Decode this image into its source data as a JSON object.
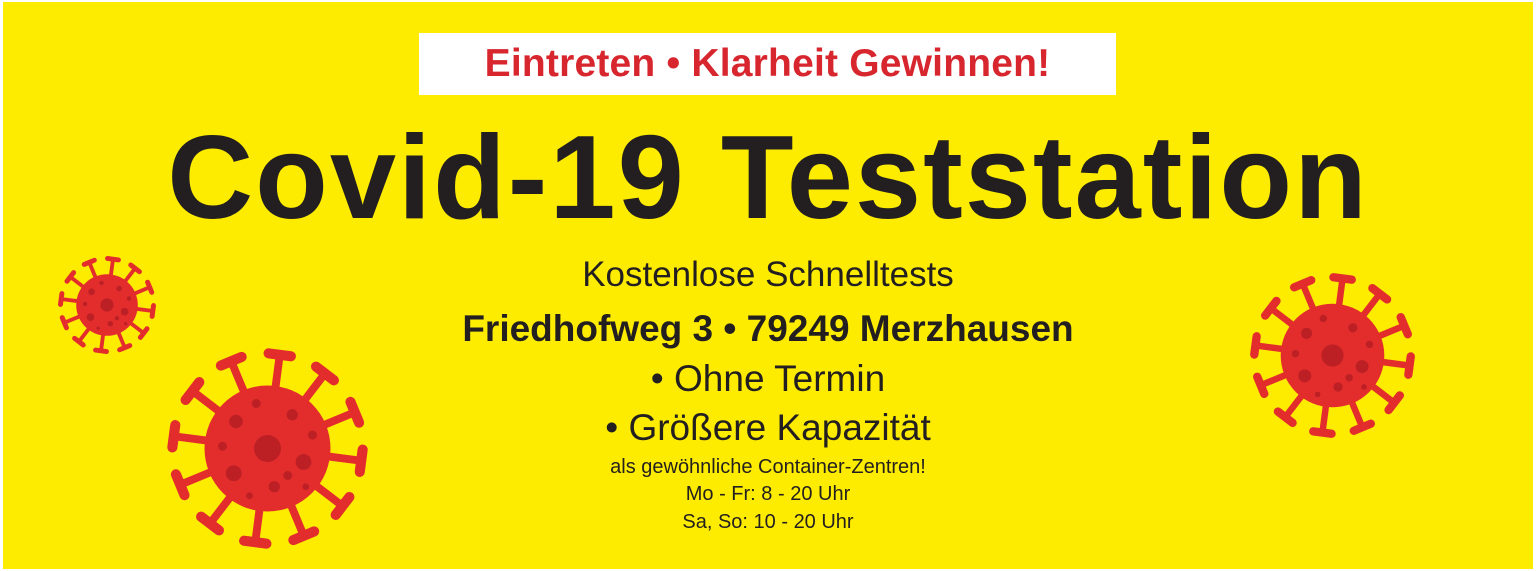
{
  "banner": {
    "tagline": "Eintreten • Klarheit Gewinnen!",
    "title": "Covid-19 Teststation",
    "subtitle": "Kostenlose Schnelltests",
    "address": "Friedhofweg 3 • 79249 Merzhausen",
    "bullets": [
      "• Ohne Termin",
      "• Größere Kapazität"
    ],
    "note": "als gewöhnliche Container-Zentren!",
    "hours": [
      "Mo - Fr: 8 - 20 Uhr",
      "Sa, So: 10 - 20 Uhr"
    ]
  },
  "illustrations": [
    "virus-icon",
    "virus-icon",
    "virus-icon"
  ],
  "colors": {
    "background": "#fdec00",
    "tagline": "#d7262e",
    "title": "#231f20",
    "text": "#231f20",
    "virus": "#e32d2d",
    "virus_dark": "#b51d23",
    "tagline_box": "#ffffff"
  }
}
